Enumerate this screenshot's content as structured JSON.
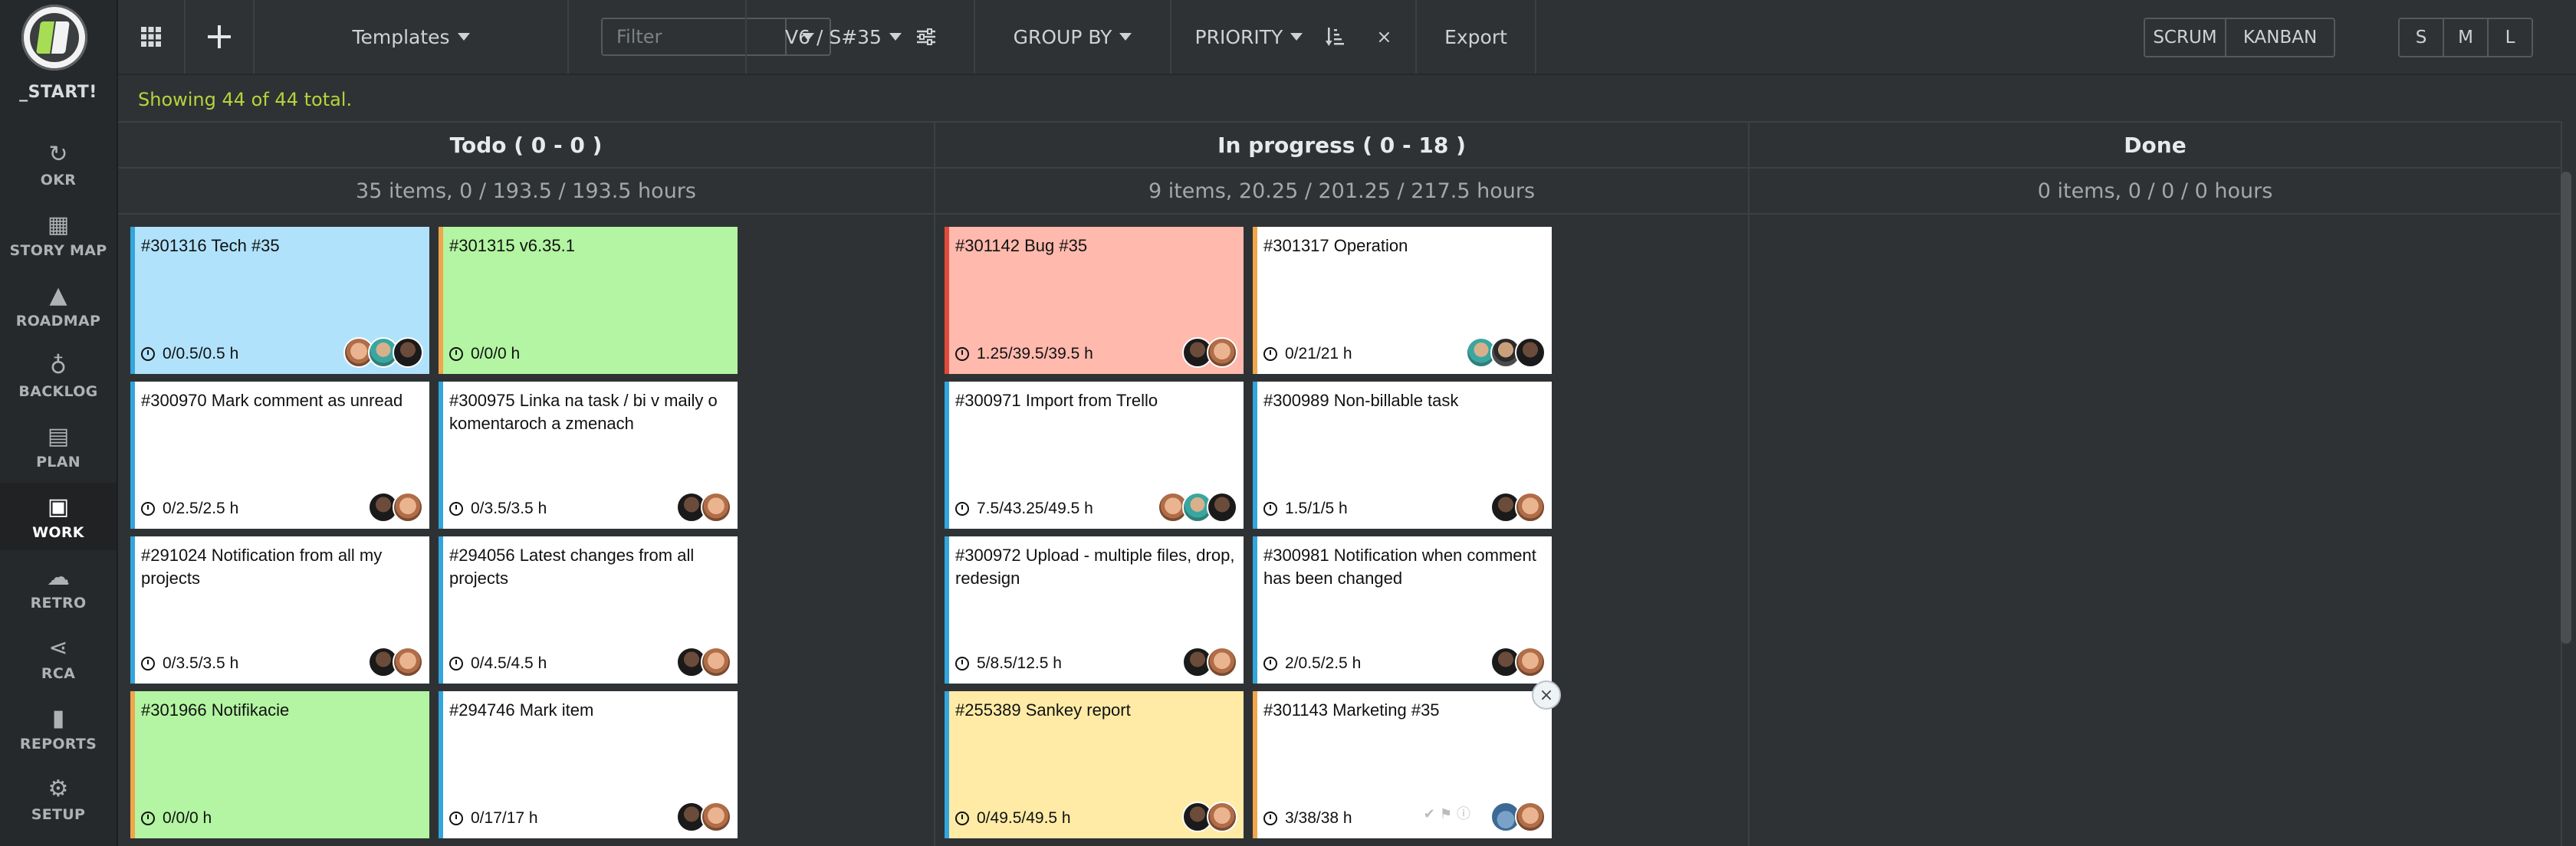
{
  "sidebar": {
    "start_label": "_START!",
    "items": [
      {
        "id": "okr",
        "label": "OKR",
        "icon": "okr-icon",
        "glyph": "↻"
      },
      {
        "id": "story-map",
        "label": "STORY MAP",
        "icon": "grid-icon",
        "glyph": "▦"
      },
      {
        "id": "roadmap",
        "label": "ROADMAP",
        "icon": "road-icon",
        "glyph": "▲"
      },
      {
        "id": "backlog",
        "label": "BACKLOG",
        "icon": "lightbulb-icon",
        "glyph": "♁"
      },
      {
        "id": "plan",
        "label": "PLAN",
        "icon": "calendar-icon",
        "glyph": "▤"
      },
      {
        "id": "work",
        "label": "WORK",
        "icon": "briefcase-icon",
        "glyph": "▣"
      },
      {
        "id": "retro",
        "label": "RETRO",
        "icon": "chat-icon",
        "glyph": "☁"
      },
      {
        "id": "rca",
        "label": "RCA",
        "icon": "share-icon",
        "glyph": "⋖"
      },
      {
        "id": "reports",
        "label": "REPORTS",
        "icon": "bar-chart-icon",
        "glyph": "▮"
      },
      {
        "id": "setup",
        "label": "SETUP",
        "icon": "gear-icon",
        "glyph": "⚙"
      }
    ]
  },
  "toolbar": {
    "templates_label": "Templates",
    "filter_placeholder": "Filter",
    "sprint_label": "V6 / S#35",
    "group_by_label": "GROUP BY",
    "priority_label": "PRIORITY",
    "clear_glyph": "×",
    "export_label": "Export",
    "mode_scrum": "SCRUM",
    "mode_kanban": "KANBAN",
    "size_s": "S",
    "size_m": "M",
    "size_l": "L"
  },
  "status_text": "Showing 44 of 44 total.",
  "columns": [
    {
      "title": "Todo ( 0 - 0 )",
      "summary": "35 items, 0 / 193.5 / 193.5 hours"
    },
    {
      "title": "In progress ( 0 - 18 )",
      "summary": "9 items, 20.25 / 201.25 / 217.5 hours"
    },
    {
      "title": "Done",
      "summary": "0 items, 0 / 0 / 0 hours"
    }
  ],
  "cards": [
    {
      "title": "#301316 Tech #35",
      "time": "0/0.5/0.5 h",
      "bg": "#b0e2fb",
      "stripe": "#33a5dd",
      "avatars": [
        "a",
        "c",
        "d"
      ]
    },
    {
      "title": "#301315 v6.35.1",
      "time": "0/0/0 h",
      "bg": "#b3f5a2",
      "stripe": "#f0a64a",
      "avatars": []
    },
    {
      "title": "#300970 Mark comment as unread",
      "time": "0/2.5/2.5 h",
      "bg": "#ffffff",
      "stripe": "#33a5dd",
      "avatars": [
        "d",
        "a"
      ]
    },
    {
      "title": "#300975 Linka na task / bi v maily o komentaroch a zmenach",
      "time": "0/3.5/3.5 h",
      "bg": "#ffffff",
      "stripe": "#33a5dd",
      "avatars": [
        "d",
        "a"
      ]
    },
    {
      "title": "#291024 Notification from all my projects",
      "time": "0/3.5/3.5 h",
      "bg": "#ffffff",
      "stripe": "#33a5dd",
      "avatars": [
        "d",
        "a"
      ]
    },
    {
      "title": "#294056 Latest changes from all projects",
      "time": "0/4.5/4.5 h",
      "bg": "#ffffff",
      "stripe": "#33a5dd",
      "avatars": [
        "d",
        "a"
      ]
    },
    {
      "title": "#301966 Notifikacie",
      "time": "0/0/0 h",
      "bg": "#b3f5a2",
      "stripe": "#f0a64a",
      "avatars": []
    },
    {
      "title": "#294746 Mark item",
      "time": "0/17/17 h",
      "bg": "#ffffff",
      "stripe": "#33a5dd",
      "avatars": [
        "d",
        "a"
      ]
    },
    {
      "title": "#301142 Bug #35",
      "time": "1.25/39.5/39.5 h",
      "bg": "#ffb9ad",
      "stripe": "#e04a3a",
      "avatars": [
        "d",
        "a"
      ]
    },
    {
      "title": "#301317 Operation",
      "time": "0/21/21 h",
      "bg": "#ffffff",
      "stripe": "#f0a64a",
      "avatars": [
        "c",
        "b",
        "d"
      ]
    },
    {
      "title": "#300971 Import from Trello",
      "time": "7.5/43.25/49.5 h",
      "bg": "#ffffff",
      "stripe": "#33a5dd",
      "avatars": [
        "a",
        "c",
        "d"
      ]
    },
    {
      "title": "#300989 Non-billable task",
      "time": "1.5/1/5 h",
      "bg": "#ffffff",
      "stripe": "#33a5dd",
      "avatars": [
        "d",
        "a"
      ]
    },
    {
      "title": "#300972 Upload - multiple files, drop, redesign",
      "time": "5/8.5/12.5 h",
      "bg": "#ffffff",
      "stripe": "#33a5dd",
      "avatars": [
        "d",
        "a"
      ]
    },
    {
      "title": "#300981 Notification when comment has been changed",
      "time": "2/0.5/2.5 h",
      "bg": "#ffffff",
      "stripe": "#33a5dd",
      "avatars": [
        "d",
        "a"
      ]
    },
    {
      "title": "#255389 Sankey report",
      "time": "0/49.5/49.5 h",
      "bg": "#ffeba6",
      "stripe": "#33a5dd",
      "avatars": [
        "d",
        "a"
      ]
    },
    {
      "title": "#301143 Marketing #35",
      "time": "3/38/38 h",
      "bg": "#ffffff",
      "stripe": "#f0a64a",
      "avatars": [
        "e",
        "a"
      ]
    }
  ],
  "close_glyph": "×"
}
